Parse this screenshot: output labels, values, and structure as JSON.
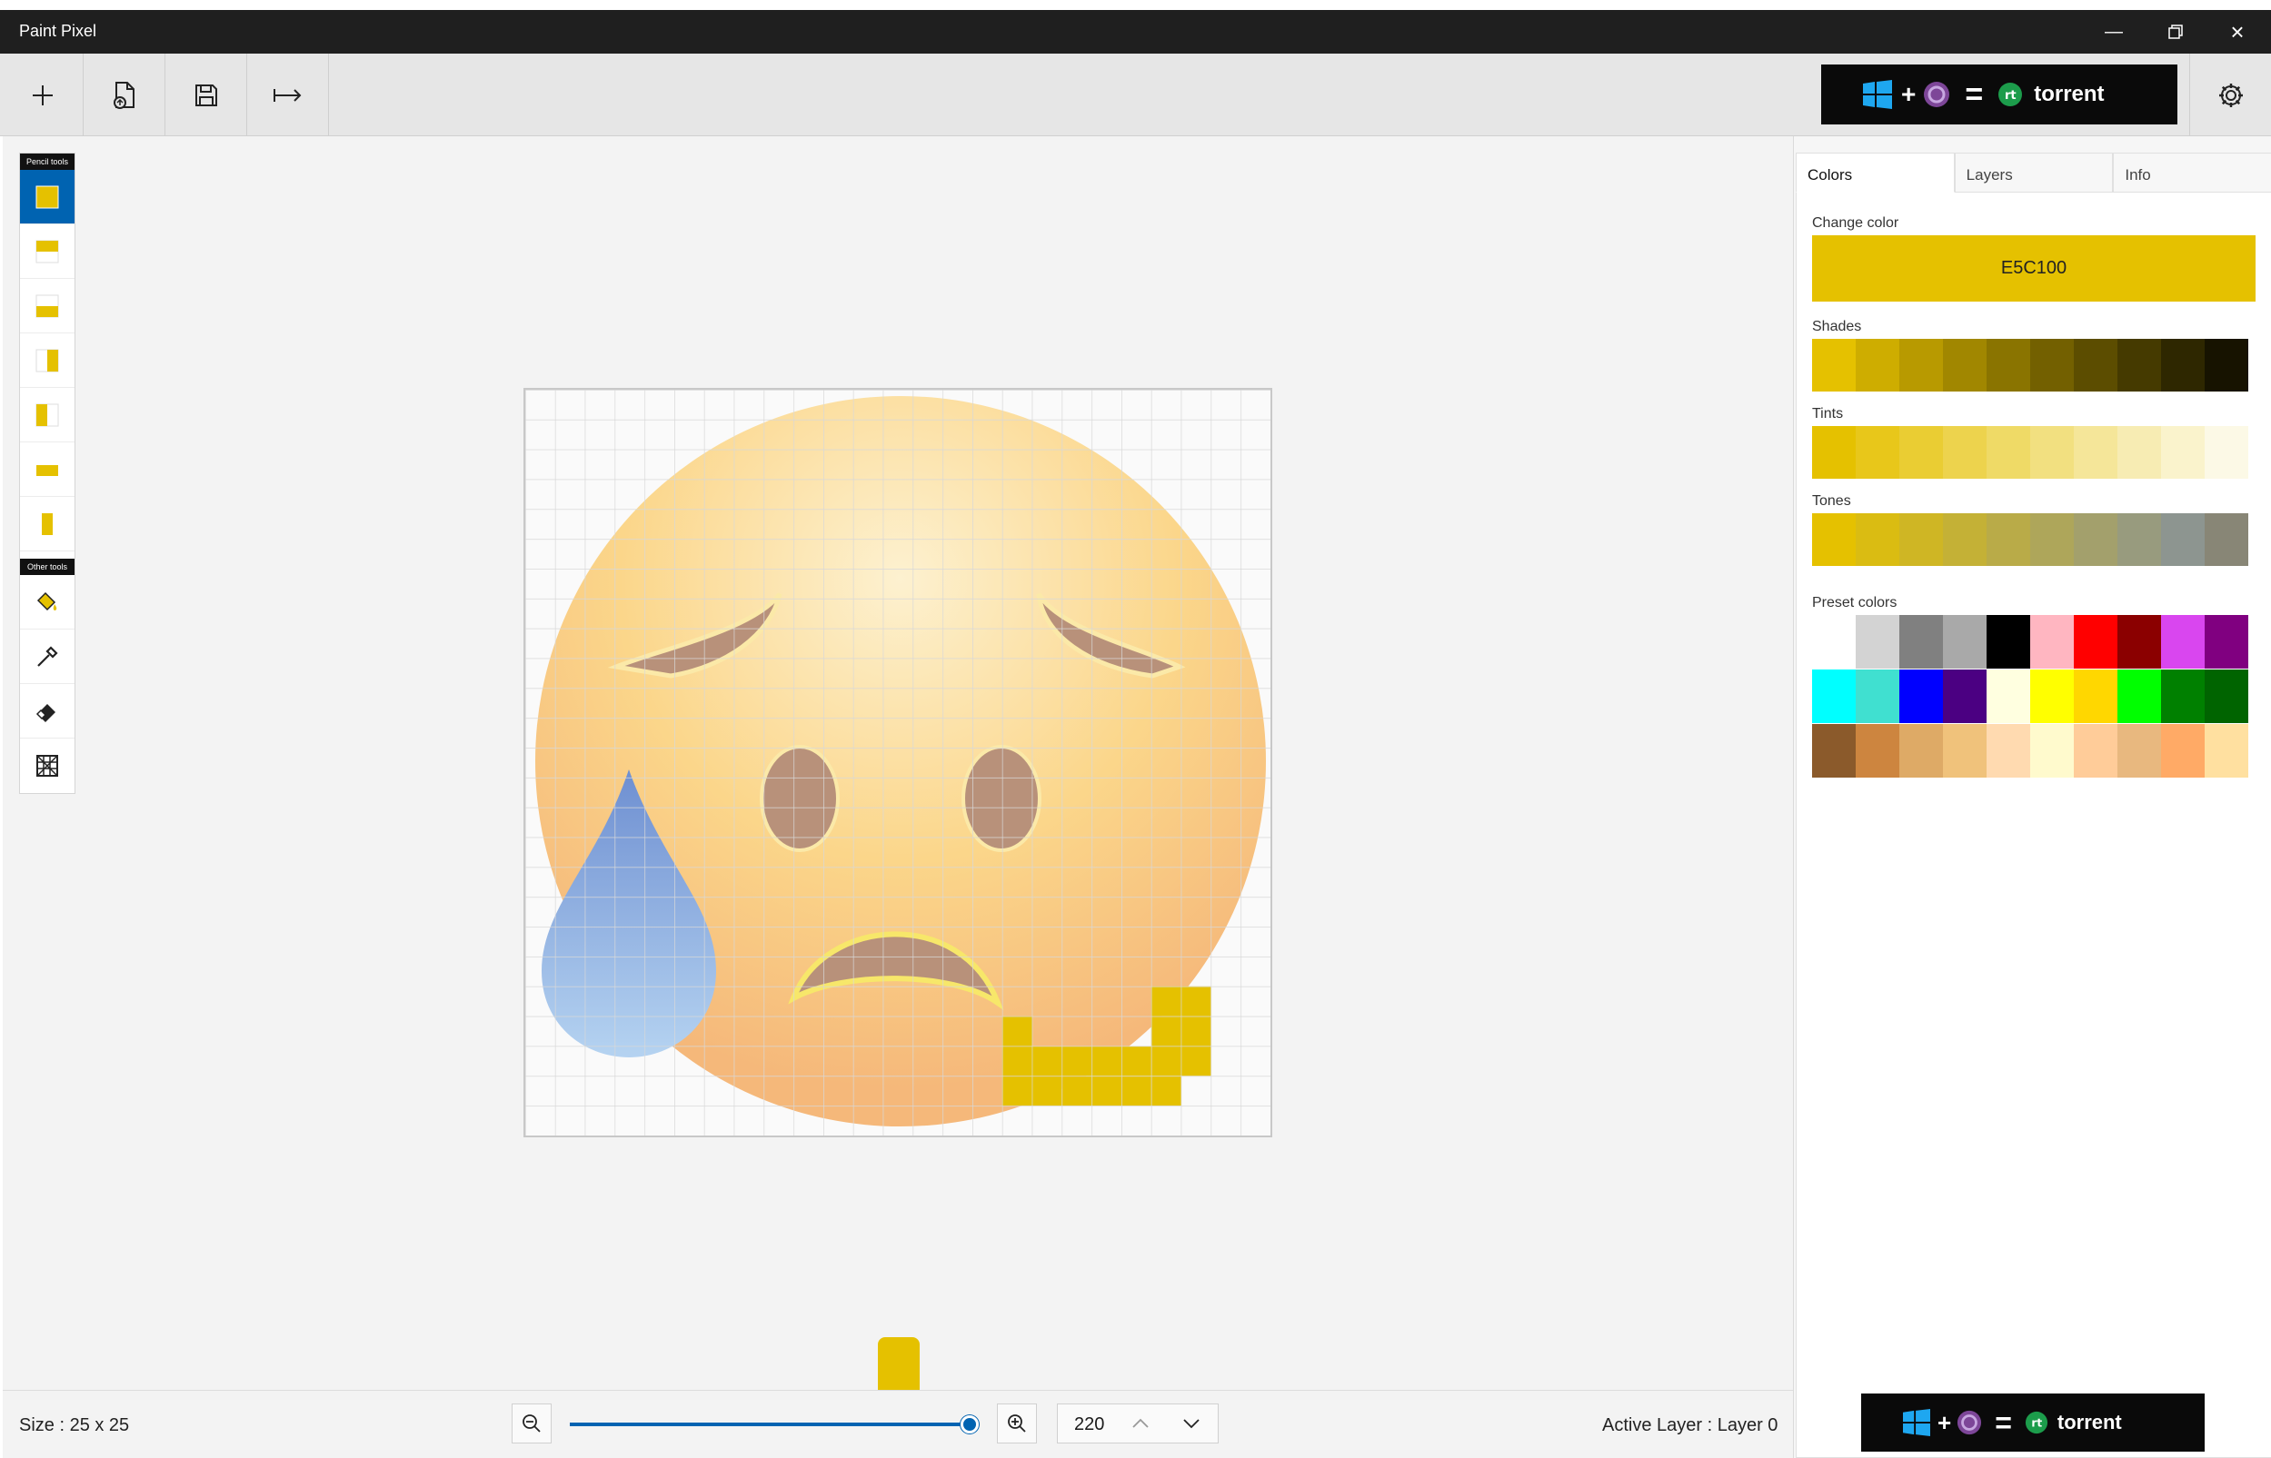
{
  "window": {
    "title": "Paint Pixel"
  },
  "ads": {
    "text": "torrent"
  },
  "tools": {
    "pencil_label": "Pencil tools",
    "other_label": "Other tools"
  },
  "tabs": [
    {
      "label": "Colors"
    },
    {
      "label": "Layers"
    },
    {
      "label": "Info"
    }
  ],
  "colors": {
    "change_color_label": "Change color",
    "current_hex": "E5C100",
    "current_color": "#E5C100",
    "shades_label": "Shades",
    "shades": [
      "#E5C100",
      "#CEAD00",
      "#B89A00",
      "#A18700",
      "#8A7400",
      "#736000",
      "#5C4D00",
      "#453A00",
      "#2E2700",
      "#171300"
    ],
    "tints_label": "Tints",
    "tints": [
      "#E5C100",
      "#E8C71A",
      "#EACD33",
      "#EDD34D",
      "#EFDA66",
      "#F2E080",
      "#F5E699",
      "#F7ECB3",
      "#FAF3CC",
      "#FCF9E6"
    ],
    "tones_label": "Tones",
    "tones": [
      "#E5C100",
      "#DABC12",
      "#CFB624",
      "#C4B136",
      "#B9AB48",
      "#AEA65A",
      "#A3A06C",
      "#989B7E",
      "#8D9590",
      "#888676"
    ],
    "preset_label": "Preset colors",
    "presets": [
      [
        "#FFFFFF",
        "#D3D3D3",
        "#808080",
        "#A9A9A9",
        "#000000",
        "#FFB6C1",
        "#FF0000",
        "#8B0000",
        "#D946EF",
        "#800080"
      ],
      [
        "#00FFFF",
        "#40E0D0",
        "#0000FF",
        "#4B0082",
        "#FFFFE0",
        "#FFFF00",
        "#FFD700",
        "#00FF00",
        "#008000",
        "#006400"
      ],
      [
        "#8B5A2B",
        "#CD853F",
        "#DEAA66",
        "#F0C27B",
        "#FFDAB0",
        "#FFFACD",
        "#FFCC99",
        "#E8B87F",
        "#FFAA66",
        "#FFE0A0"
      ]
    ]
  },
  "status": {
    "size": "Size : 25 x 25",
    "zoom_value": "220",
    "zoom_slider_fraction": 1.0,
    "active_layer": "Active Layer : Layer 0"
  }
}
